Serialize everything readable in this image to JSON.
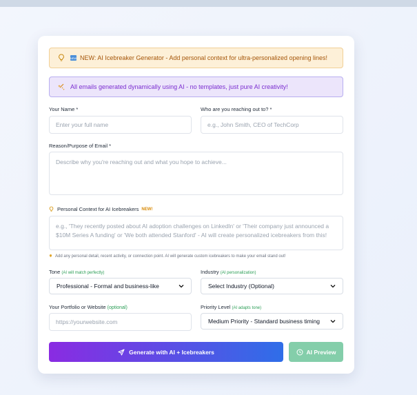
{
  "banner_new": {
    "text": "NEW: AI Icebreaker Generator - Add personal context for ultra-personalized opening lines!",
    "icon_tag": "NEW"
  },
  "banner_ai": {
    "text": "All emails generated dynamically using AI - no templates, just pure AI creativity!"
  },
  "fields": {
    "name": {
      "label": "Your Name",
      "required": "*",
      "placeholder": "Enter your full name"
    },
    "recipient": {
      "label": "Who are you reaching out to?",
      "required": "*",
      "placeholder": "e.g., John Smith, CEO of TechCorp"
    },
    "reason": {
      "label": "Reason/Purpose of Email",
      "required": "*",
      "placeholder": "Describe why you're reaching out and what you hope to achieve..."
    },
    "context": {
      "label": "Personal Context for AI Icebreakers",
      "badge": "NEW!",
      "placeholder": "e.g., 'They recently posted about AI adoption challenges on LinkedIn' or 'Their company just announced a $10M Series A funding' or 'We both attended Stanford' - AI will create personalized icebreakers from this!",
      "note": "Add any personal detail, recent activity, or connection point. AI will generate custom icebreakers to make your email stand out!"
    },
    "tone": {
      "label": "Tone",
      "hint": "(AI will match perfectly)",
      "value": "Professional - Formal and business-like"
    },
    "industry": {
      "label": "Industry",
      "hint": "(AI personalization)",
      "value": "Select Industry (Optional)"
    },
    "portfolio": {
      "label": "Your Portfolio or Website",
      "hint": "(optional)",
      "placeholder": "https://yourwebsite.com"
    },
    "priority": {
      "label": "Priority Level",
      "hint": "(AI adapts tone)",
      "value": "Medium Priority - Standard business timing"
    }
  },
  "buttons": {
    "generate": "Generate with AI + Icebreakers",
    "preview": "AI Preview"
  },
  "colors": {
    "accent_purple": "#8a2be2",
    "accent_blue": "#2f6ee8",
    "preview_green": "#84ceaa",
    "hint_green": "#2a9d55"
  }
}
